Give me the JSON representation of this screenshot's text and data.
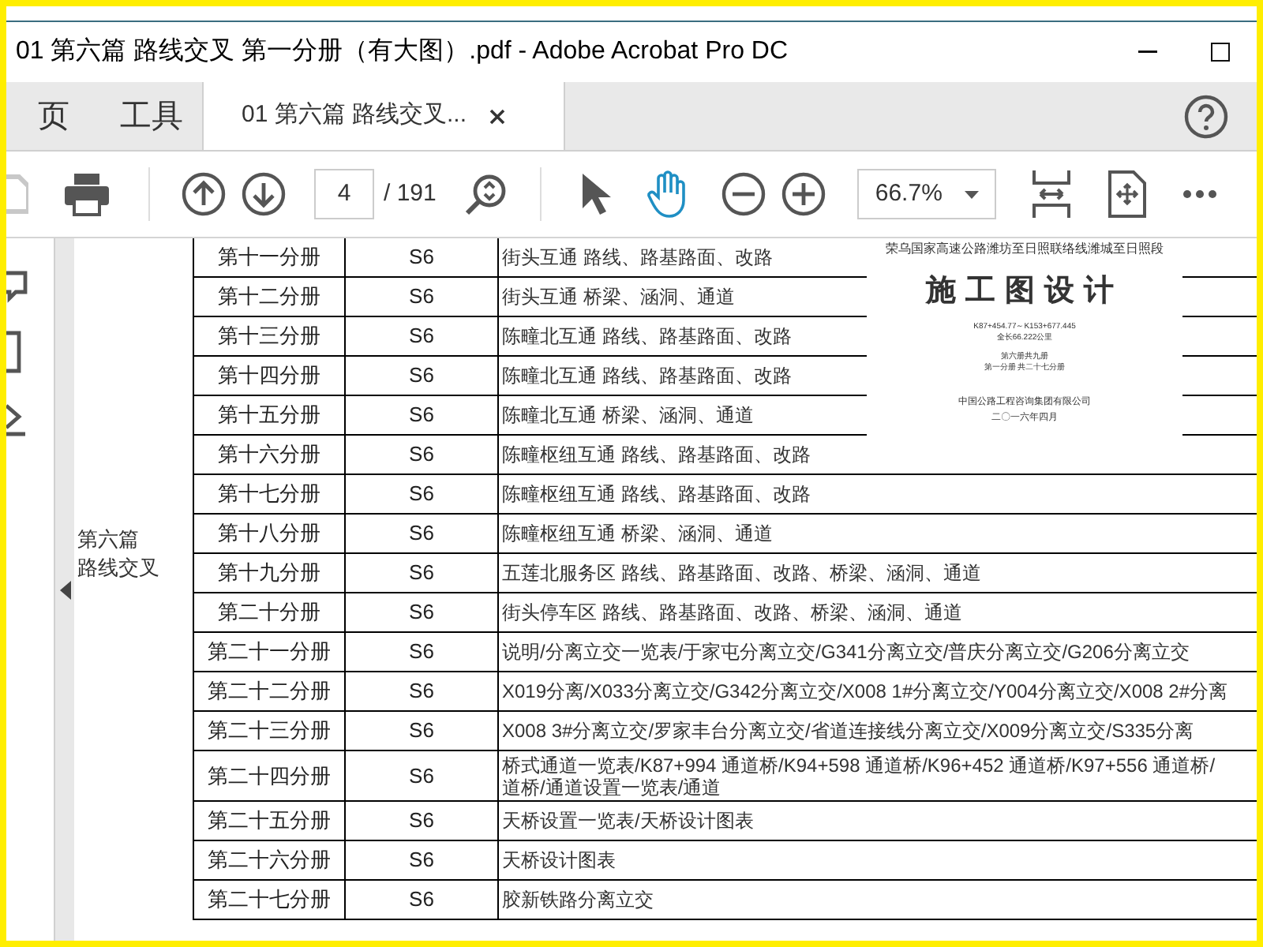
{
  "window": {
    "title": "01 第六篇 路线交叉 第一分册（有大图）.pdf - Adobe Acrobat Pro DC"
  },
  "tabs": [
    {
      "label": "页",
      "selected": false,
      "closable": false
    },
    {
      "label": "工具",
      "selected": false,
      "closable": false
    },
    {
      "label": "01 第六篇 路线交叉...",
      "selected": true,
      "closable": true
    }
  ],
  "toolbar": {
    "page": "4",
    "page_total": "/ 191",
    "zoom": "66.7%"
  },
  "document": {
    "section": [
      "第六篇",
      "路线交叉"
    ],
    "rows": [
      {
        "volume": "第十一分册",
        "code": "S6",
        "content": [
          "街头互通 路线、路基路面、改路"
        ]
      },
      {
        "volume": "第十二分册",
        "code": "S6",
        "content": [
          "街头互通 桥梁、涵洞、通道"
        ]
      },
      {
        "volume": "第十三分册",
        "code": "S6",
        "content": [
          "陈疃北互通 路线、路基路面、改路"
        ]
      },
      {
        "volume": "第十四分册",
        "code": "S6",
        "content": [
          "陈疃北互通 路线、路基路面、改路"
        ]
      },
      {
        "volume": "第十五分册",
        "code": "S6",
        "content": [
          "陈疃北互通 桥梁、涵洞、通道"
        ]
      },
      {
        "volume": "第十六分册",
        "code": "S6",
        "content": [
          "陈疃枢纽互通 路线、路基路面、改路"
        ]
      },
      {
        "volume": "第十七分册",
        "code": "S6",
        "content": [
          "陈疃枢纽互通 路线、路基路面、改路"
        ]
      },
      {
        "volume": "第十八分册",
        "code": "S6",
        "content": [
          "陈疃枢纽互通 桥梁、涵洞、通道"
        ]
      },
      {
        "volume": "第十九分册",
        "code": "S6",
        "content": [
          "五莲北服务区 路线、路基路面、改路、桥梁、涵洞、通道"
        ]
      },
      {
        "volume": "第二十分册",
        "code": "S6",
        "content": [
          "街头停车区 路线、路基路面、改路、桥梁、涵洞、通道"
        ]
      },
      {
        "volume": "第二十一分册",
        "code": "S6",
        "content": [
          "说明/分离立交一览表/于家屯分离立交/G341分离立交/普庆分离立交/G206分离立交"
        ]
      },
      {
        "volume": "第二十二分册",
        "code": "S6",
        "content": [
          "X019分离/X033分离立交/G342分离立交/X008 1#分离立交/Y004分离立交/X008 2#分离"
        ]
      },
      {
        "volume": "第二十三分册",
        "code": "S6",
        "content": [
          "X008 3#分离立交/罗家丰台分离立交/省道连接线分离立交/X009分离立交/S335分离"
        ]
      },
      {
        "volume": "第二十四分册",
        "code": "S6",
        "content": [
          "桥式通道一览表/K87+994 通道桥/K94+598 通道桥/K96+452 通道桥/K97+556 通道桥/",
          "道桥/通道设置一览表/通道"
        ]
      },
      {
        "volume": "第二十五分册",
        "code": "S6",
        "content": [
          "天桥设置一览表/天桥设计图表"
        ]
      },
      {
        "volume": "第二十六分册",
        "code": "S6",
        "content": [
          "天桥设计图表"
        ]
      },
      {
        "volume": "第二十七分册",
        "code": "S6",
        "content": [
          "胶新铁路分离立交"
        ]
      }
    ],
    "cover": {
      "project": "荣乌国家高速公路潍坊至日照联络线潍城至日照段",
      "heading": "施工图设计",
      "chainage": "K87+454.77～K153+677.445",
      "length": "全长66.222公里",
      "book": "第六册共九册",
      "part": "第一分册 共二十七分册",
      "company": "中国公路工程咨询集团有限公司",
      "date": "二〇一六年四月"
    }
  }
}
